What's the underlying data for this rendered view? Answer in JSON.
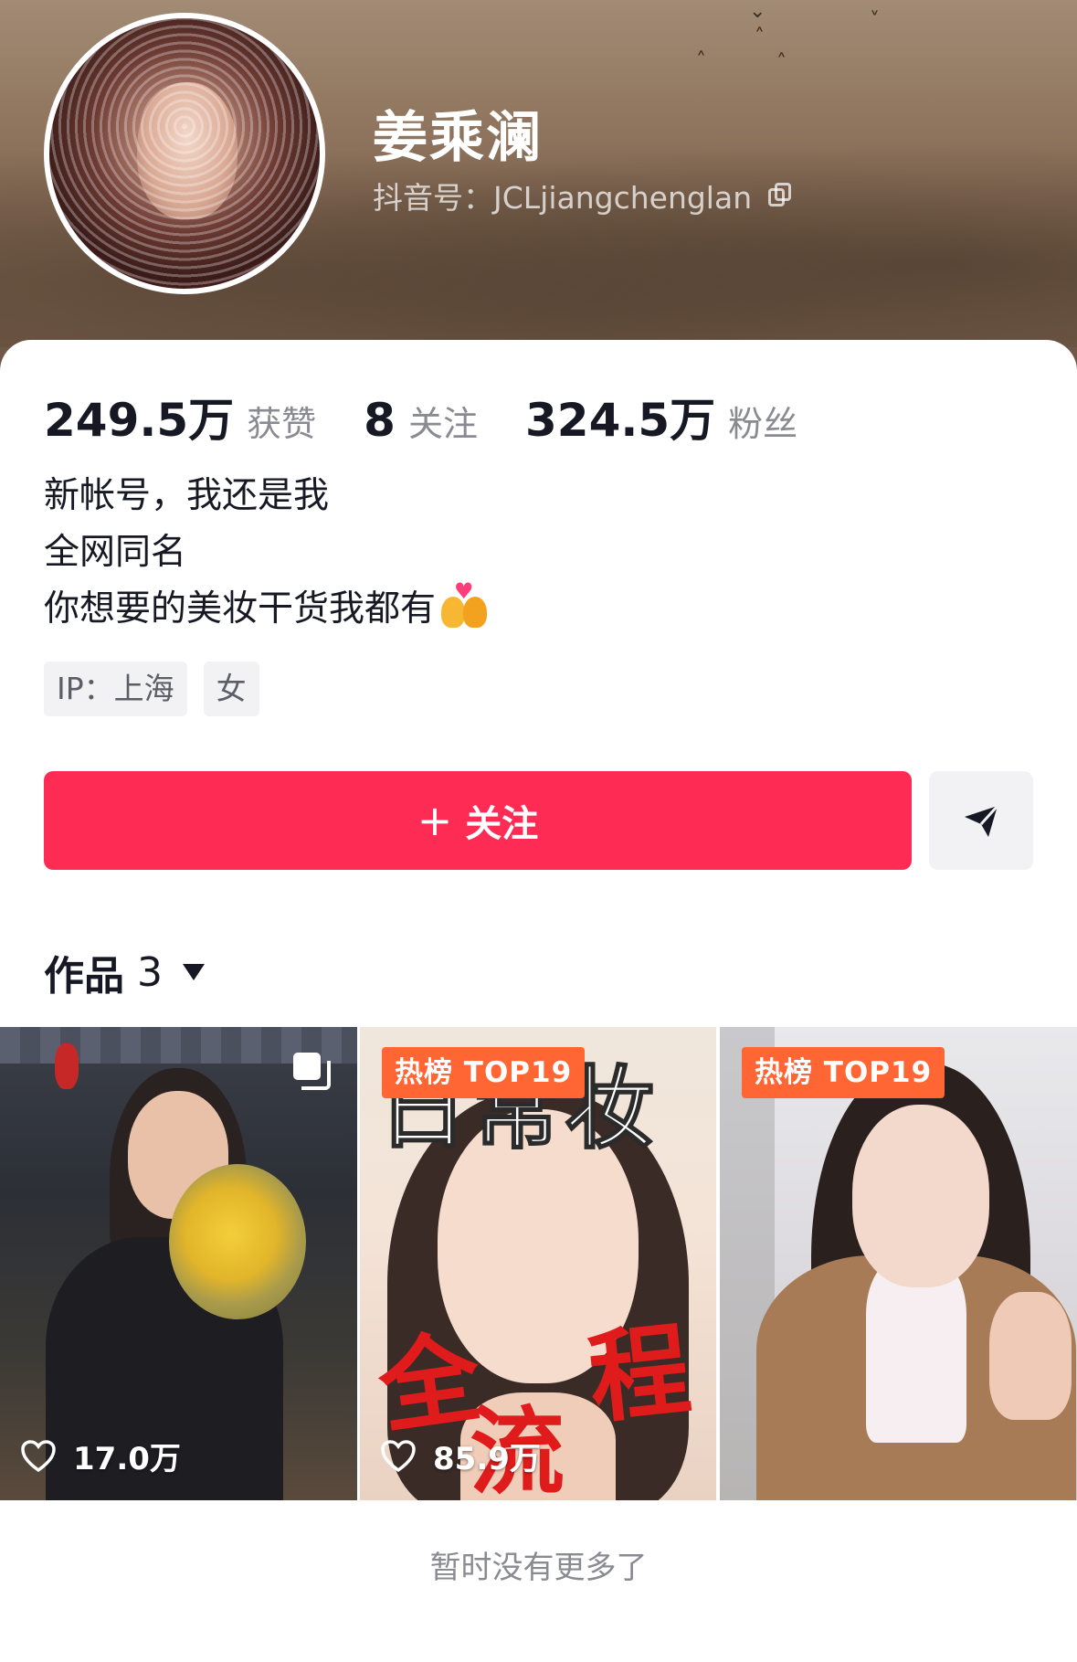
{
  "profile": {
    "name": "姜乘澜",
    "douyin_id": "抖音号：JCLjiangchenglan"
  },
  "stats": [
    {
      "value": "249.5万",
      "label": "获赞"
    },
    {
      "value": "8",
      "label": "关注"
    },
    {
      "value": "324.5万",
      "label": "粉丝"
    }
  ],
  "bio": {
    "lines": [
      "新帐号，我还是我",
      "全网同名",
      "你想要的美妆干货我都有"
    ],
    "emoji": "couple-with-heart-emoji"
  },
  "tags": [
    "IP：上海",
    "女"
  ],
  "actions": {
    "follow_label": "关注",
    "follow_icon": "plus-icon",
    "share_icon": "send-icon",
    "follow_color": "#fe2c55"
  },
  "works": {
    "label": "作品",
    "count": "3",
    "items": [
      {
        "likes": "17.0万",
        "badge": "",
        "multi_image": true
      },
      {
        "likes": "85.9万",
        "badge": "热榜 TOP19",
        "overlay_top": "日常妆",
        "overlay_bottom": [
          "全",
          "流",
          "程"
        ]
      },
      {
        "likes": "",
        "badge": "热榜 TOP19"
      }
    ]
  },
  "footer": {
    "no_more": "暂时没有更多了"
  },
  "colors": {
    "accent": "#fe2c55",
    "badge": "#ff6633",
    "banner": "#917760"
  }
}
